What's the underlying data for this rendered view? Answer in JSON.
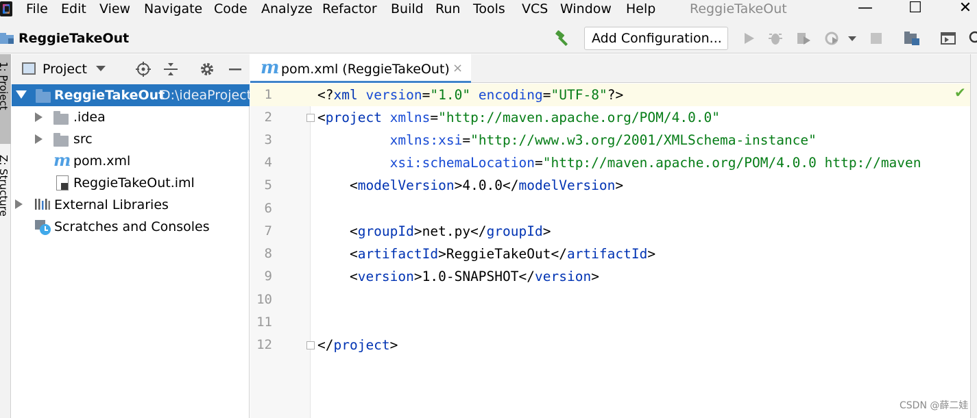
{
  "menu": {
    "items": [
      "File",
      "Edit",
      "View",
      "Navigate",
      "Code",
      "Analyze",
      "Refactor",
      "Build",
      "Run",
      "Tools",
      "VCS",
      "Window",
      "Help"
    ],
    "window_title": "ReggieTakeOut",
    "minimize": "—",
    "maximize": "☐",
    "close": "✕"
  },
  "navbar": {
    "project_name": "ReggieTakeOut",
    "add_configuration": "Add Configuration..."
  },
  "left_strip": {
    "project_tab": "1: Project",
    "structure_tab": "Z: Structure"
  },
  "project_panel": {
    "title": "Project",
    "tree": {
      "root_name": "ReggieTakeOut",
      "root_path": "D:\\ideaProject",
      "idea": ".idea",
      "src": "src",
      "pom": "pom.xml",
      "iml": "ReggieTakeOut.iml",
      "libs": "External Libraries",
      "scratches": "Scratches and Consoles"
    }
  },
  "editor": {
    "tab_icon": "m",
    "tab_label": "pom.xml (ReggieTakeOut)",
    "tab_close": "×",
    "line_numbers": [
      "1",
      "2",
      "3",
      "4",
      "5",
      "6",
      "7",
      "8",
      "9",
      "10",
      "11",
      "12"
    ],
    "code": {
      "l1_a": "<?",
      "l1_b": "xml ",
      "l1_c": "version",
      "l1_d": "=",
      "l1_e": "\"1.0\"",
      "l1_f": " encoding",
      "l1_g": "=",
      "l1_h": "\"UTF-8\"",
      "l1_i": "?>",
      "l2_a": "<",
      "l2_b": "project ",
      "l2_c": "xmlns",
      "l2_d": "=",
      "l2_e": "\"http://maven.apache.org/POM/4.0.0\"",
      "l3_a": "         xmlns:xsi",
      "l3_b": "=",
      "l3_c": "\"http://www.w3.org/2001/XMLSchema-instance\"",
      "l4_a": "         xsi:schemaLocation",
      "l4_b": "=",
      "l4_c": "\"http://maven.apache.org/POM/4.0.0 http://maven",
      "l5_a": "    <",
      "l5_b": "modelVersion",
      "l5_c": ">4.0.0</",
      "l5_d": "modelVersion",
      "l5_e": ">",
      "l7_a": "    <",
      "l7_b": "groupId",
      "l7_c": ">net.py</",
      "l7_d": "groupId",
      "l7_e": ">",
      "l8_a": "    <",
      "l8_b": "artifactId",
      "l8_c": ">ReggieTakeOut</",
      "l8_d": "artifactId",
      "l8_e": ">",
      "l9_a": "    <",
      "l9_b": "version",
      "l9_c": ">1.0-SNAPSHOT</",
      "l9_d": "version",
      "l9_e": ">",
      "l12_a": "</",
      "l12_b": "project",
      "l12_c": ">"
    },
    "status_check": "✔"
  },
  "watermark": "CSDN @薛二娃",
  "colors": {
    "selection": "#2675bf",
    "tag": "#0033b3",
    "string": "#067d17",
    "current_line": "#fdfbe8"
  }
}
